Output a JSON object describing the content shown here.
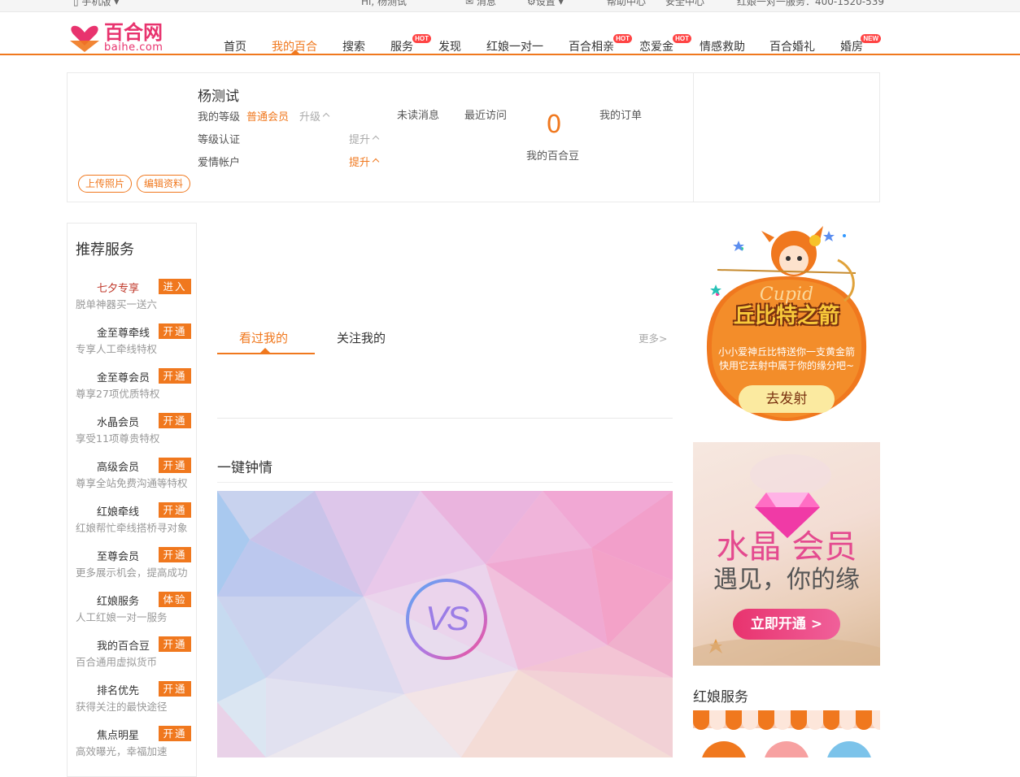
{
  "topbar": {
    "mobile": "手机版",
    "greeting": "Hi, 杨测试",
    "messages": "消息",
    "settings": "设置",
    "help": "帮助中心",
    "safety": "安全中心",
    "matchmaker": "红娘一对一服务：400-1520-539"
  },
  "logo": {
    "cn": "百合网",
    "en": "baihe.com"
  },
  "nav": [
    {
      "label": "首页"
    },
    {
      "label": "我的百合",
      "active": true
    },
    {
      "label": "搜索"
    },
    {
      "label": "服务",
      "badge": "HOT"
    },
    {
      "label": "发现"
    },
    {
      "label": "红娘一对一"
    },
    {
      "label": "百合相亲",
      "badge": "HOT"
    },
    {
      "label": "恋爱金",
      "badge": "HOT"
    },
    {
      "label": "情感救助"
    },
    {
      "label": "百合婚礼"
    },
    {
      "label": "婚房",
      "badge": "NEW"
    }
  ],
  "profile": {
    "name": "杨测试",
    "level_label": "我的等级",
    "level_value": "普通会员",
    "upgrade": "升级",
    "cert_label": "等级认证",
    "cert_action": "提升",
    "love_label": "爱情帐户",
    "love_action": "提升",
    "unread": "未读消息",
    "recent": "最近访问",
    "beans_count": "0",
    "beans_label": "我的百合豆",
    "orders": "我的订单",
    "upload_photo": "上传照片",
    "edit_profile": "编辑资料"
  },
  "sidebar": {
    "title": "推荐服务",
    "items": [
      {
        "name": "七夕专享",
        "desc": "脱单神器买一送六",
        "action": "进入",
        "highlight": true
      },
      {
        "name": "金至尊牵线",
        "desc": "专享人工牵线特权",
        "action": "开通"
      },
      {
        "name": "金至尊会员",
        "desc": "尊享27项优质特权",
        "action": "开通"
      },
      {
        "name": "水晶会员",
        "desc": "享受11项尊贵特权",
        "action": "开通"
      },
      {
        "name": "高级会员",
        "desc": "尊享全站免费沟通等特权",
        "action": "开通"
      },
      {
        "name": "红娘牵线",
        "desc": "红娘帮忙牵线搭桥寻对象",
        "action": "开通"
      },
      {
        "name": "至尊会员",
        "desc": "更多展示机会，提高成功",
        "action": "开通"
      },
      {
        "name": "红娘服务",
        "desc": "人工红娘一对一服务",
        "action": "体验"
      },
      {
        "name": "我的百合豆",
        "desc": "百合通用虚拟货币",
        "action": "开通"
      },
      {
        "name": "排名优先",
        "desc": "获得关注的最快途径",
        "action": "开通"
      },
      {
        "name": "焦点明星",
        "desc": "高效曝光，幸福加速",
        "action": "开通"
      }
    ]
  },
  "center": {
    "tab_viewed": "看过我的",
    "tab_followed": "关注我的",
    "more": "更多>",
    "section_title": "一键钟情",
    "vs": "VS"
  },
  "right": {
    "cupid_title": "丘比特之箭",
    "cupid_sub": "Cupid",
    "cupid_line1": "小小爱神丘比特送你一支黄金箭",
    "cupid_line2": "快用它去射中属于你的缘分吧~",
    "cupid_button": "去发射",
    "crystal_title": "水晶 会员",
    "crystal_sub": "遇见，你的缘",
    "crystal_button": "立即开通 >",
    "hongniang_title": "红娘服务"
  },
  "colors": {
    "accent": "#f0781e",
    "brand_pink": "#e8336e"
  }
}
